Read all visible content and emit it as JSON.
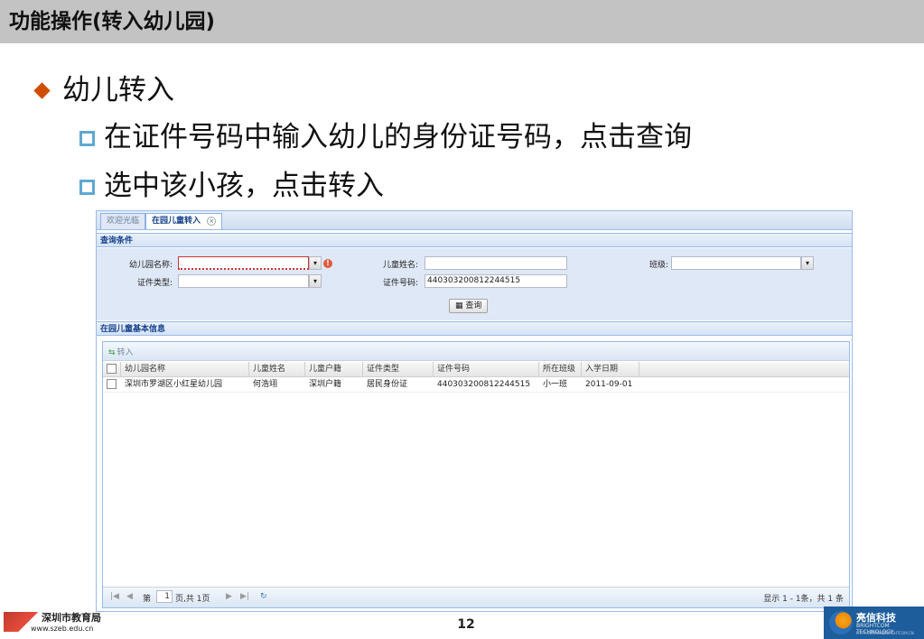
{
  "slide": {
    "title": "功能操作(转入幼儿园)",
    "bullets": [
      "幼儿转入",
      "在证件号码中输入幼儿的身份证号码，点击查询",
      "选中该小孩，点击转入"
    ],
    "page_number": "12"
  },
  "app": {
    "tabs": [
      {
        "label": "欢迎光临"
      },
      {
        "label": "在园儿童转入"
      }
    ],
    "query_panel_title": "查询条件",
    "form": {
      "kindergarten_label": "幼儿园名称:",
      "child_name_label": "儿童姓名:",
      "class_label": "班级:",
      "id_type_label": "证件类型:",
      "id_number_label": "证件号码:",
      "id_number_value": "440303200812244515",
      "search_button": "查询"
    },
    "info_panel_title": "在园儿童基本信息",
    "toolbar": {
      "transfer_button": "转入"
    },
    "grid": {
      "columns": [
        "幼儿园名称",
        "儿童姓名",
        "儿童户籍",
        "证件类型",
        "证件号码",
        "所在班级",
        "入学日期"
      ],
      "rows": [
        [
          "深圳市罗湖区小红星幼儿园",
          "何浩翊",
          "深圳户籍",
          "居民身份证",
          "440303200812244515",
          "小一班",
          "2011-09-01"
        ]
      ]
    },
    "pager": {
      "page_prefix": "第",
      "page_value": "1",
      "page_suffix": "页,共 1页",
      "summary": "显示 1 - 1条，共 1 条"
    }
  },
  "footer": {
    "left_org": "深圳市教育局",
    "left_url": "www.szeb.edu.cn",
    "right_org": "亮信科技",
    "right_sub": "BRIGHTCOM TECHNOLOGY",
    "right_url": "HTTP://WWW.SZBRIGHTCOM.CN"
  }
}
